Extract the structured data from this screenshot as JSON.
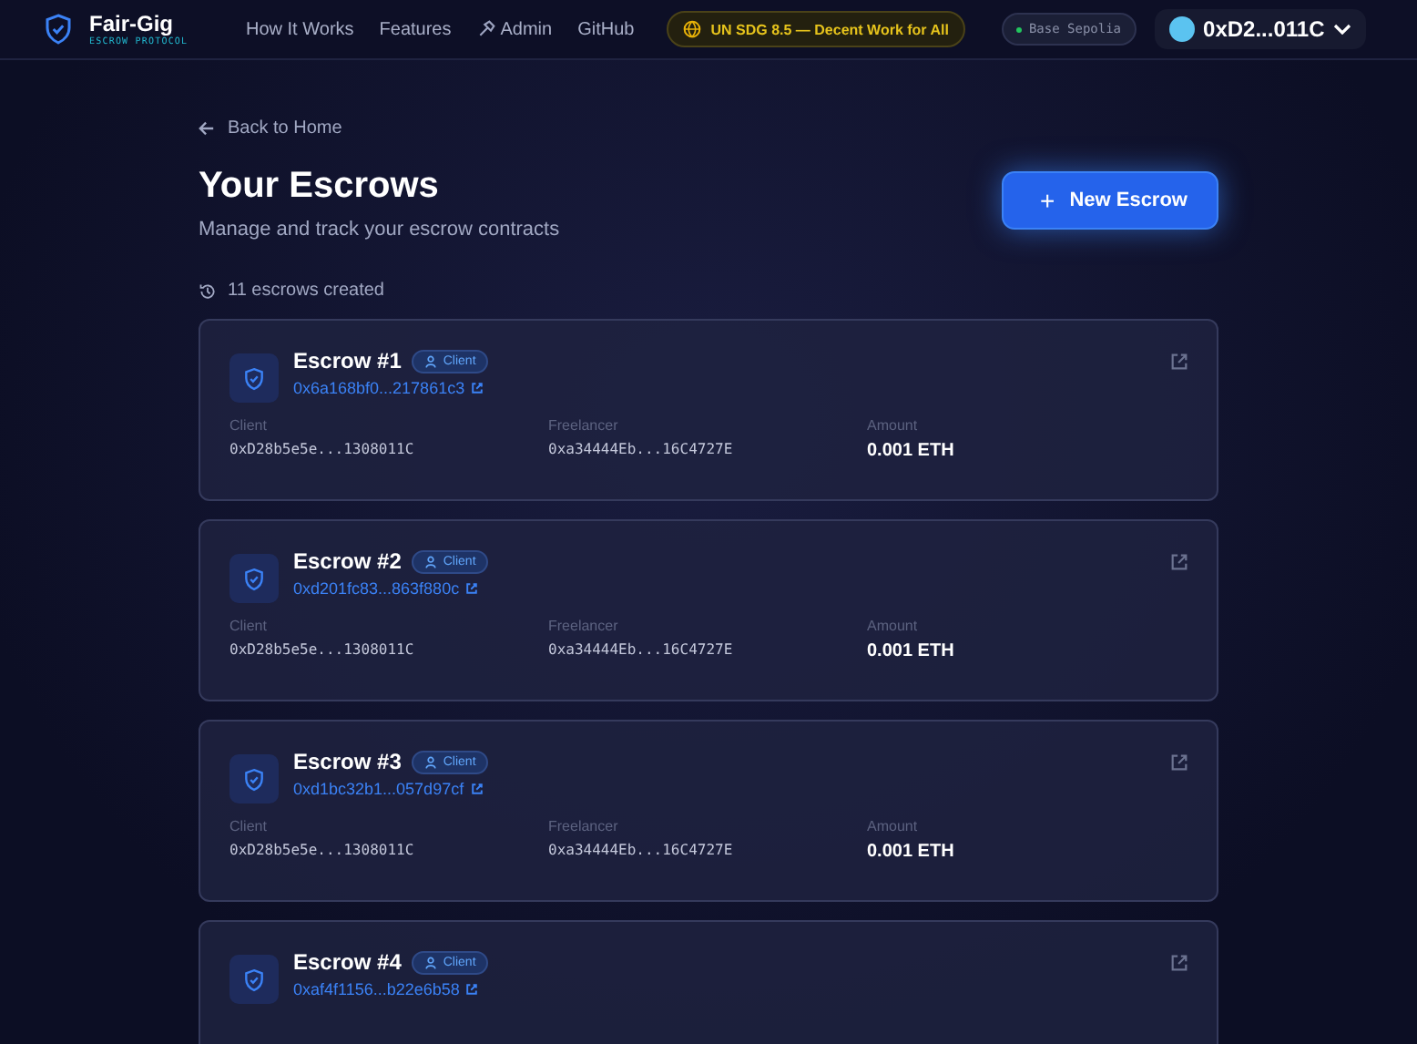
{
  "brand": {
    "name": "Fair-Gig",
    "tagline": "ESCROW PROTOCOL"
  },
  "nav": [
    {
      "label": "How It Works",
      "icon": false
    },
    {
      "label": "Features",
      "icon": false
    },
    {
      "label": "Admin",
      "icon": true
    },
    {
      "label": "GitHub",
      "icon": false
    }
  ],
  "sdg_badge": "UN SDG 8.5 — Decent Work for All",
  "network": "Base Sepolia",
  "wallet": "0xD2...011C",
  "back_link": "Back to Home",
  "title": "Your Escrows",
  "subtitle": "Manage and track your escrow contracts",
  "new_button": "New Escrow",
  "new_button_icon": "+",
  "count": "11 escrows created",
  "escrows": [
    {
      "title": "Escrow #1",
      "role": "Client",
      "hash": "0x6a168bf0...217861c3",
      "client_label": "Client",
      "client": "0xD28b5e5e...1308011C",
      "freelancer_label": "Freelancer",
      "freelancer": "0xa34444Eb...16C4727E",
      "amount_label": "Amount",
      "amount": "0.001 ETH"
    },
    {
      "title": "Escrow #2",
      "role": "Client",
      "hash": "0xd201fc83...863f880c",
      "client_label": "Client",
      "client": "0xD28b5e5e...1308011C",
      "freelancer_label": "Freelancer",
      "freelancer": "0xa34444Eb...16C4727E",
      "amount_label": "Amount",
      "amount": "0.001 ETH"
    },
    {
      "title": "Escrow #3",
      "role": "Client",
      "hash": "0xd1bc32b1...057d97cf",
      "client_label": "Client",
      "client": "0xD28b5e5e...1308011C",
      "freelancer_label": "Freelancer",
      "freelancer": "0xa34444Eb...16C4727E",
      "amount_label": "Amount",
      "amount": "0.001 ETH"
    },
    {
      "title": "Escrow #4",
      "role": "Client",
      "hash": "0xaf4f1156...b22e6b58"
    }
  ]
}
